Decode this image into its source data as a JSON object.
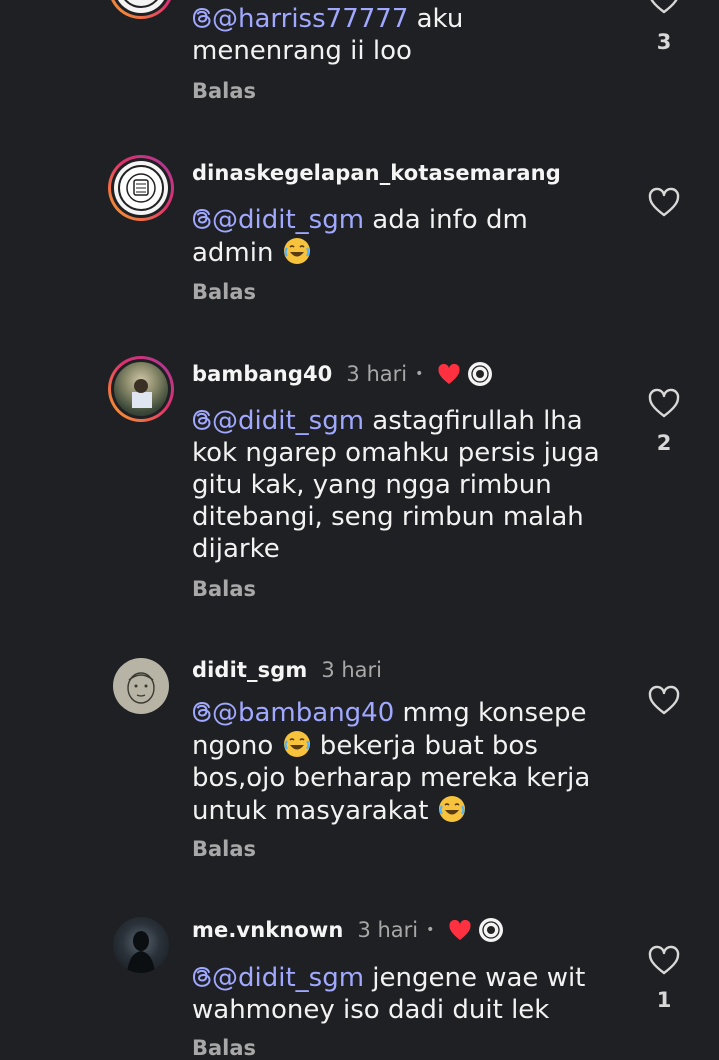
{
  "comments": [
    {
      "mention": "@harriss77777",
      "text": " aku menenrang ii loo",
      "reply_label": "Balas",
      "like_count": "3"
    },
    {
      "username": "dinaskegelapan_kotasemarang",
      "mention": "@didit_sgm",
      "text": " ada info dm admin ",
      "reply_label": "Balas",
      "like_count": ""
    },
    {
      "username": "bambang40",
      "time": "3 hari",
      "separator": "•",
      "mention": "@didit_sgm",
      "text": " astagfirullah lha kok ngarep omahku persis juga gitu kak, yang ngga rimbun ditebangi, seng rimbun malah dijarke",
      "reply_label": "Balas",
      "like_count": "2"
    },
    {
      "username": "didit_sgm",
      "time": "3 hari",
      "mention": "@bambang40",
      "text_part1": " mmg konsepe ngono ",
      "text_part2": " bekerja buat bos bos,ojo berharap mereka kerja untuk masyarakat ",
      "reply_label": "Balas",
      "like_count": ""
    },
    {
      "username": "me.vnknown",
      "time": "3 hari",
      "separator": "•",
      "mention": "@didit_sgm",
      "text": " jengene wae wit wahmoney iso dadi duit lek",
      "reply_label": "Balas",
      "like_count": "1"
    }
  ],
  "icons": {
    "like": "heart-outline-icon",
    "liked_by_creator": "heart-filled-icon",
    "emoji": "face-with-tears-of-joy-icon",
    "threads": "threads-icon"
  },
  "colors": {
    "background": "#1f2023",
    "mention": "#a0a8ff",
    "heart": "#ff3040",
    "secondary_text": "#a8a8a8"
  }
}
